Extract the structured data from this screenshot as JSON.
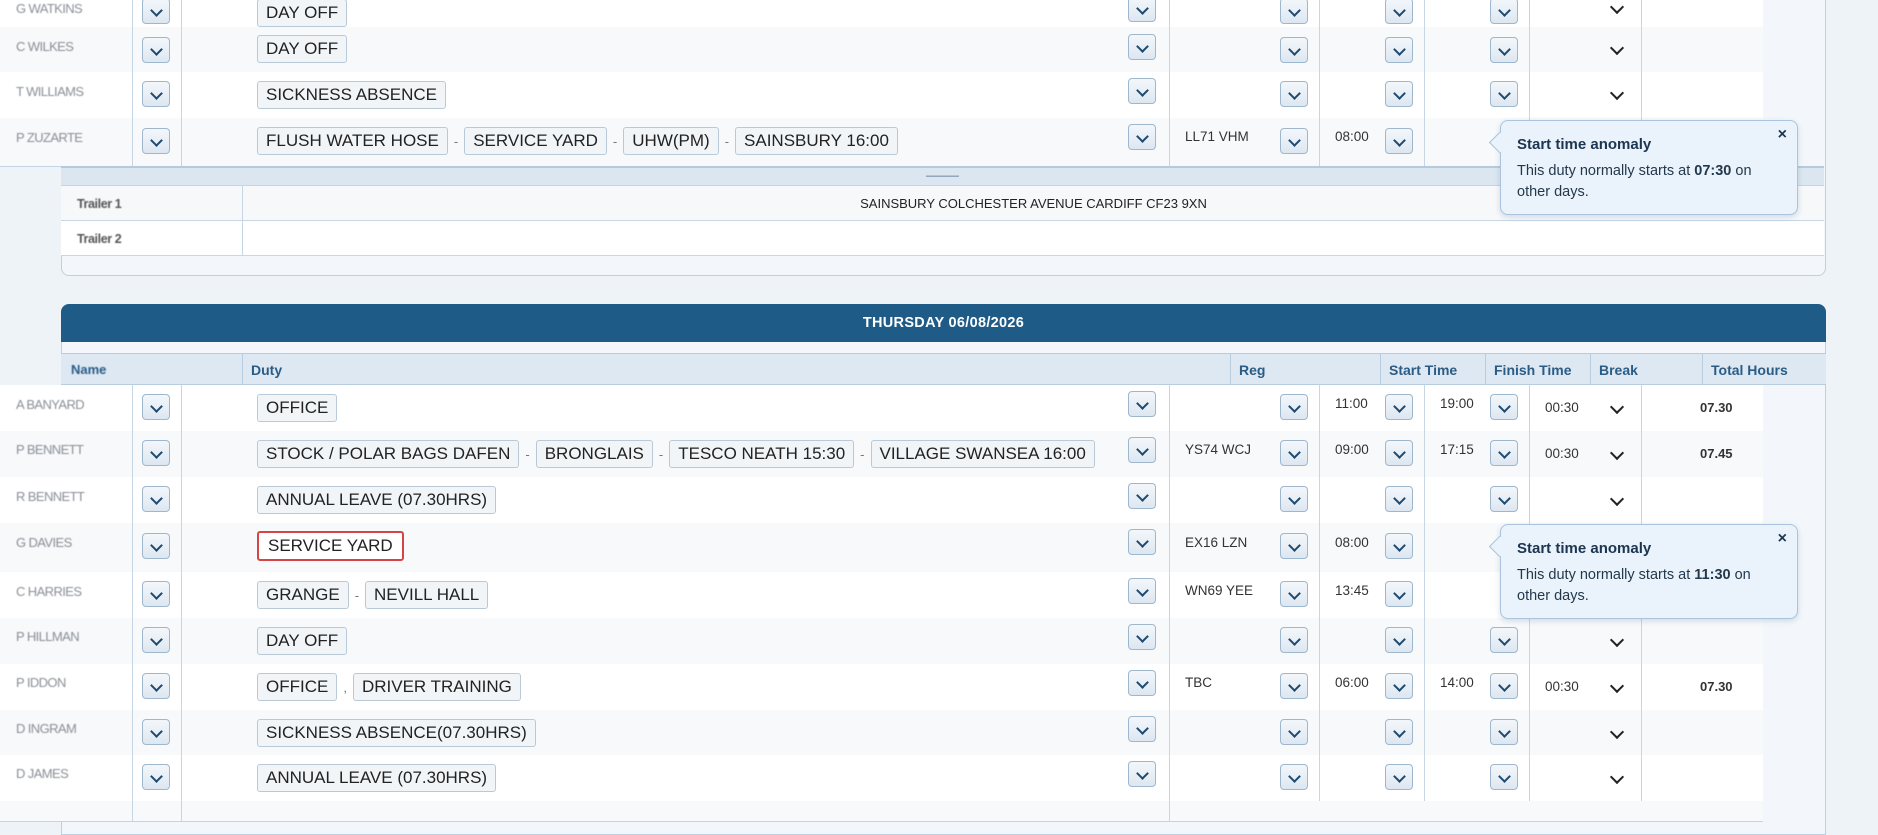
{
  "top_section": {
    "rows": [
      {
        "name": "G WATKINS",
        "duties": [
          "DAY OFF"
        ],
        "reg": "",
        "start": "",
        "finish": "",
        "break": "",
        "total": ""
      },
      {
        "name": "C WILKES",
        "duties": [
          "DAY OFF"
        ],
        "reg": "",
        "start": "",
        "finish": "",
        "break": "",
        "total": ""
      },
      {
        "name": "T WILLIAMS",
        "duties": [
          "SICKNESS ABSENCE"
        ],
        "reg": "",
        "start": "",
        "finish": "",
        "break": "",
        "total": ""
      },
      {
        "name": "P ZUZARTE",
        "duties": [
          "FLUSH WATER HOSE",
          "SERVICE YARD",
          "UHW(PM)",
          "SAINSBURY 16:00"
        ],
        "reg": "LL71 VHM",
        "start": "08:00",
        "finish": "",
        "break": "",
        "total": ""
      }
    ],
    "divider": "———",
    "trailers": [
      {
        "label": "Trailer 1",
        "text": "SAINSBURY COLCHESTER AVENUE CARDIFF CF23 9XN"
      },
      {
        "label": "Trailer 2",
        "text": ""
      }
    ],
    "popover": {
      "title": "Start time anomaly",
      "body_prefix": "This duty normally starts at ",
      "time": "07:30",
      "body_suffix": " on other days.",
      "close": "×"
    }
  },
  "day_section": {
    "title": "THURSDAY 06/08/2026",
    "columns": {
      "name": "Name",
      "duty": "Duty",
      "reg": "Reg",
      "start": "Start Time",
      "finish": "Finish Time",
      "break": "Break",
      "total": "Total Hours"
    },
    "rows": [
      {
        "name": "A BANYARD",
        "duties": [
          "OFFICE"
        ],
        "reg": "",
        "start": "11:00",
        "finish": "19:00",
        "break": "00:30",
        "total": "07.30"
      },
      {
        "name": "P BENNETT",
        "duties": [
          "STOCK / POLAR BAGS DAFEN",
          "BRONGLAIS",
          "TESCO NEATH 15:30",
          "VILLAGE SWANSEA 16:00"
        ],
        "reg": "YS74 WCJ",
        "start": "09:00",
        "finish": "17:15",
        "break": "00:30",
        "total": "07.45"
      },
      {
        "name": "R BENNETT",
        "duties": [
          "ANNUAL LEAVE (07.30HRS)"
        ],
        "reg": "",
        "start": "",
        "finish": "",
        "break": "",
        "total": ""
      },
      {
        "name": "G DAVIES",
        "duties": [
          "SERVICE YARD"
        ],
        "reg": "EX16 LZN",
        "start": "08:00",
        "finish": "",
        "break": "",
        "total": ""
      },
      {
        "name": "C HARRIES",
        "duties": [
          "GRANGE",
          "NEVILL HALL"
        ],
        "reg": "WN69 YEE",
        "start": "13:45",
        "finish": "",
        "break": "",
        "total": ""
      },
      {
        "name": "P HILLMAN",
        "duties": [
          "DAY OFF"
        ],
        "reg": "",
        "start": "",
        "finish": "",
        "break": "",
        "total": ""
      },
      {
        "name": "P IDDON",
        "duties": [
          "OFFICE",
          "DRIVER TRAINING"
        ],
        "reg": "TBC",
        "start": "06:00",
        "finish": "14:00",
        "break": "00:30",
        "total": "07.30"
      },
      {
        "name": "D INGRAM",
        "duties": [
          "SICKNESS ABSENCE(07.30HRS)"
        ],
        "reg": "",
        "start": "",
        "finish": "",
        "break": "",
        "total": ""
      },
      {
        "name": "D JAMES",
        "duties": [
          "ANNUAL LEAVE (07.30HRS)"
        ],
        "reg": "",
        "start": "",
        "finish": "",
        "break": "",
        "total": ""
      }
    ],
    "popover": {
      "title": "Start time anomaly",
      "body_prefix": "This duty normally starts at ",
      "time": "11:30",
      "body_suffix": " on other days.",
      "close": "×"
    }
  },
  "separators": {
    "dash": "-",
    "comma": ","
  },
  "colors": {
    "header_bg": "#1f5b87",
    "column_header_bg": "#dde8f2",
    "highlight_border": "#d64545",
    "popover_bg": "#eaf3fb"
  }
}
